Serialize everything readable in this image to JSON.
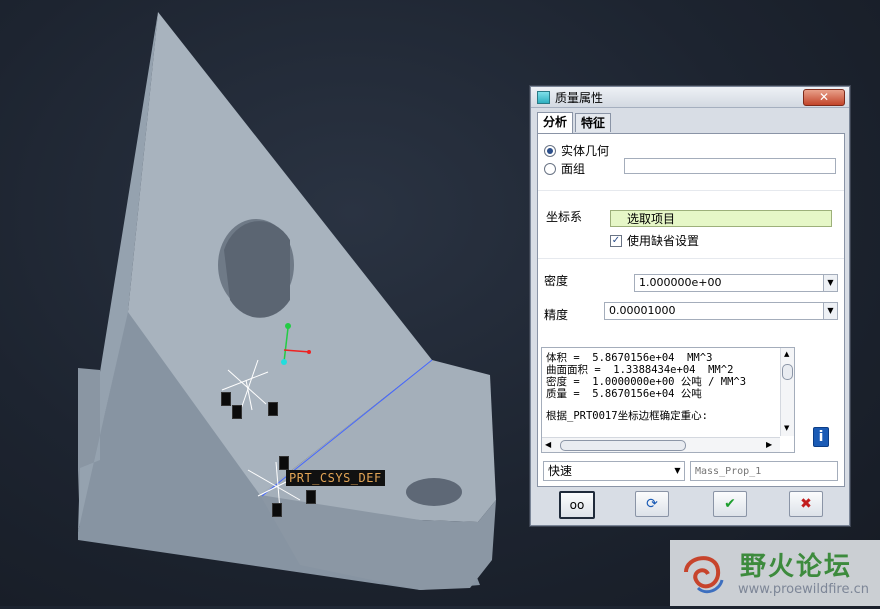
{
  "dialog": {
    "title": "质量属性",
    "close_label": "✕",
    "tabs": [
      "分析",
      "特征"
    ],
    "geometry": {
      "option_solid": "实体几何",
      "option_quilt": "面组",
      "quilt_value": ""
    },
    "coord": {
      "label": "坐标系",
      "select_value": "选取项目",
      "use_default_label": "使用缺省设置",
      "use_default_checked": true
    },
    "density": {
      "label": "密度",
      "value": "1.000000e+00"
    },
    "accuracy": {
      "label": "精度",
      "value": "0.00001000"
    },
    "results": [
      "体积 =  5.8670156e+04  MM^3",
      "曲面面积 =  1.3388434e+04  MM^2",
      "密度 =  1.0000000e+00 公吨 / MM^3",
      "质量 =  5.8670156e+04 公吨",
      "",
      "根据_PRT0017坐标边框确定重心:"
    ],
    "mode_value": "快速",
    "name_placeholder": "Mass_Prop_1"
  },
  "viewport": {
    "csys_label": "PRT_CSYS_DEF"
  },
  "watermark": {
    "title": "野火论坛",
    "url": "www.proewildfire.cn"
  }
}
